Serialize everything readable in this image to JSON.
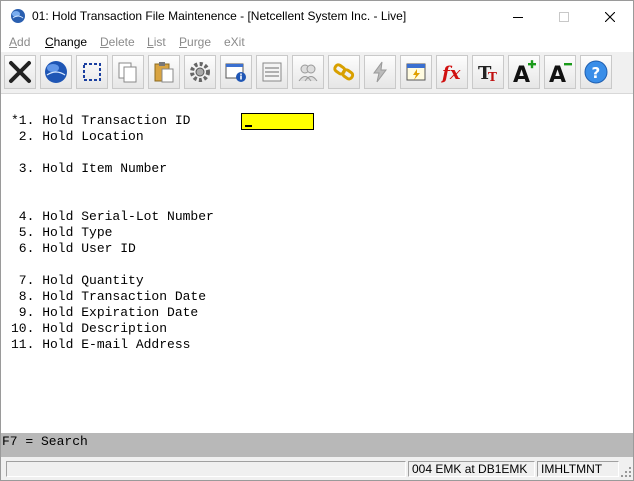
{
  "window": {
    "title": "01: Hold Transaction File Maintenence - [Netcellent System Inc. - Live]"
  },
  "menu": [
    {
      "label": "Add",
      "ul": "A",
      "rest": "dd",
      "active": false
    },
    {
      "label": "Change",
      "ul": "C",
      "rest": "hange",
      "active": true
    },
    {
      "label": "Delete",
      "ul": "D",
      "rest": "elete",
      "active": false
    },
    {
      "label": "List",
      "ul": "L",
      "rest": "ist",
      "active": false
    },
    {
      "label": "Purge",
      "ul": "P",
      "rest": "urge",
      "active": false
    },
    {
      "label": "eXit",
      "ul": "",
      "rest": "",
      "active": false
    }
  ],
  "toolbar": [
    "close-x-icon",
    "globe-icon",
    "select-icon",
    "copy-icon",
    "paste-icon",
    "settings-icon",
    "info-window-icon",
    "list-icon",
    "users-icon",
    "link-icon",
    "lightning-icon",
    "calendar-icon",
    "function-icon",
    "font-icon",
    "increase-font-icon",
    "decrease-font-icon",
    "help-icon"
  ],
  "form": {
    "fields": [
      {
        "label": "*1. Hold Transaction ID"
      },
      {
        "label": " 2. Hold Location"
      },
      {
        "label": " 3. Hold Item Number"
      },
      {
        "label": " 4. Hold Serial-Lot Number"
      },
      {
        "label": " 5. Hold Type"
      },
      {
        "label": " 6. Hold User ID"
      },
      {
        "label": " 7. Hold Quantity"
      },
      {
        "label": " 8. Hold Transaction Date"
      },
      {
        "label": " 9. Hold Expiration Date"
      },
      {
        "label": "10. Hold Description"
      },
      {
        "label": "11. Hold E-mail Address"
      }
    ],
    "input_value": "",
    "input_color": "#ffff00"
  },
  "fkeys": {
    "text": "F7 = Search"
  },
  "status": {
    "main": "",
    "user": "004 EMK at DB1EMK",
    "program": "IMHLTMNT"
  }
}
